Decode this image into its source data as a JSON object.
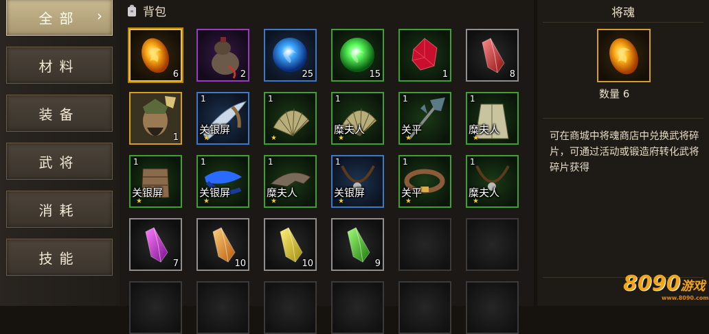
{
  "tabs": [
    "全部",
    "材料",
    "装备",
    "武将",
    "消耗",
    "技能"
  ],
  "active_tab_chevron": "›",
  "header": {
    "title": "背包",
    "icon": "bag-icon"
  },
  "slots": [
    {
      "rarity": "orange",
      "icon": "fire-soul-orb-icon",
      "count": "6",
      "selected": true
    },
    {
      "rarity": "purple",
      "icon": "gourd-bottle-icon",
      "count": "2"
    },
    {
      "rarity": "blue",
      "icon": "blue-orb-icon",
      "count": "25"
    },
    {
      "rarity": "green",
      "icon": "green-orb-icon",
      "count": "15"
    },
    {
      "rarity": "green",
      "icon": "red-gem-icon",
      "count": "1"
    },
    {
      "rarity": "gray",
      "icon": "red-crystal-icon",
      "count": "8"
    },
    {
      "rarity": "orange",
      "icon": "general-portrait-icon",
      "count": "1"
    },
    {
      "rarity": "blue",
      "icon": "blade-fragment-icon",
      "top": "1",
      "hero": "关银屏",
      "star": "★"
    },
    {
      "rarity": "green",
      "icon": "fan-fragment-icon",
      "top": "1",
      "star": "★"
    },
    {
      "rarity": "green",
      "icon": "fan-fragment-icon",
      "top": "1",
      "hero": "糜夫人",
      "star": "★"
    },
    {
      "rarity": "green",
      "icon": "halberd-fragment-icon",
      "top": "1",
      "hero": "关平",
      "star": "★"
    },
    {
      "rarity": "green",
      "icon": "robe-fragment-icon",
      "top": "1",
      "hero": "糜夫人",
      "star": "★"
    },
    {
      "rarity": "green",
      "icon": "armor-fragment-icon",
      "top": "1",
      "hero": "关银屏",
      "star": "★"
    },
    {
      "rarity": "green",
      "icon": "blue-sash-fragment-icon",
      "top": "1",
      "hero": "关银屏",
      "star": "★"
    },
    {
      "rarity": "green",
      "icon": "wing-fragment-icon",
      "top": "1",
      "hero": "糜夫人",
      "star": "★"
    },
    {
      "rarity": "blue",
      "icon": "necklace-fragment-icon",
      "top": "1",
      "hero": "关银屏",
      "star": "★"
    },
    {
      "rarity": "green",
      "icon": "belt-fragment-icon",
      "top": "1",
      "hero": "关平",
      "star": "★"
    },
    {
      "rarity": "green",
      "icon": "necklace-fragment-icon",
      "top": "1",
      "hero": "糜夫人",
      "star": "★"
    },
    {
      "rarity": "gray",
      "icon": "purple-crystal-icon",
      "count": "7"
    },
    {
      "rarity": "gray",
      "icon": "orange-crystal-icon",
      "count": "10"
    },
    {
      "rarity": "gray",
      "icon": "yellow-crystal-icon",
      "count": "10"
    },
    {
      "rarity": "gray",
      "icon": "green-crystal-icon",
      "count": "9"
    },
    {
      "rarity": "empty"
    },
    {
      "rarity": "empty"
    },
    {
      "rarity": "empty"
    },
    {
      "rarity": "empty"
    },
    {
      "rarity": "empty"
    },
    {
      "rarity": "empty"
    },
    {
      "rarity": "empty"
    },
    {
      "rarity": "empty"
    }
  ],
  "detail": {
    "title": "将魂",
    "icon": "fire-soul-orb-icon",
    "quantity_label": "数量 6",
    "description": "可在商城中将魂商店中兑换武将碎片，可通过活动或锻造府转化武将碎片获得"
  },
  "watermark": {
    "logo": "8090",
    "text": "游戏",
    "url": "www.8090.com"
  },
  "colors": {
    "orange_border": "#d8a020",
    "green_border": "#3fa22e",
    "blue_border": "#3b79c9",
    "purple_border": "#9b3bc4",
    "gray_border": "#8f8f8f",
    "accent": "#f0c030"
  }
}
